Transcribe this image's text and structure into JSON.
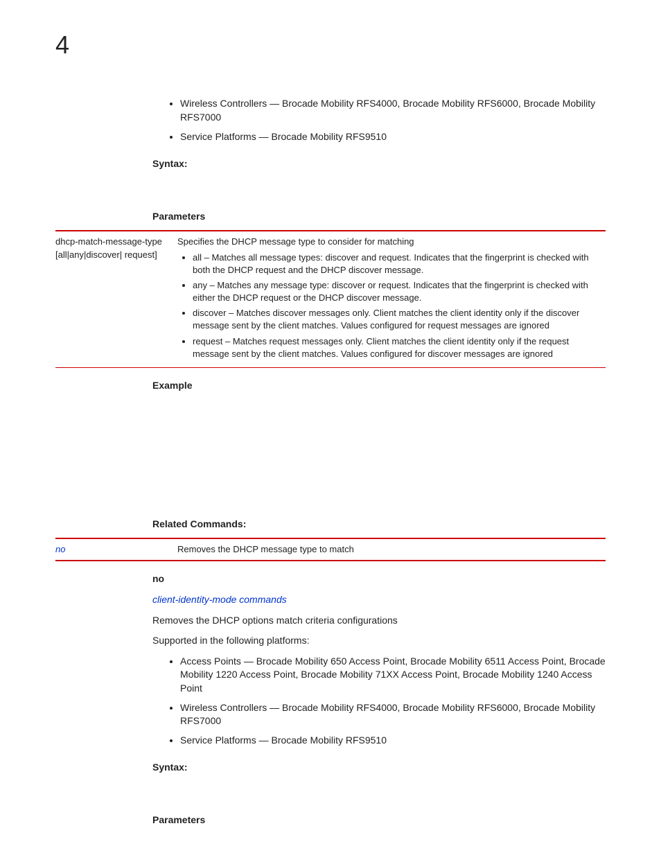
{
  "page_number": "4",
  "top_bullets": [
    "Wireless Controllers — Brocade Mobility RFS4000, Brocade Mobility RFS6000, Brocade Mobility RFS7000",
    "Service Platforms — Brocade Mobility RFS9510"
  ],
  "syntax_label": "Syntax:",
  "parameters_label": "Parameters",
  "param_row": {
    "left": "dhcp-match-message-type [all|any|discover| request]",
    "desc": "Specifies the DHCP message type to consider for matching",
    "items": [
      "all – Matches all message types: discover and request. Indicates that the fingerprint is checked with both the DHCP request and the DHCP discover message.",
      "any – Matches any message type: discover or request. Indicates that the fingerprint is checked with either the DHCP request or the DHCP discover message.",
      "discover – Matches discover messages only. Client matches the client identity only if the discover message sent by the client matches. Values configured for request messages are ignored",
      "request – Matches request messages only. Client matches the client identity only if the request message sent by the client matches. Values configured for discover messages are ignored"
    ]
  },
  "example_label": "Example",
  "related_label": "Related Commands:",
  "related_row": {
    "cmd": "no",
    "desc": "Removes the DHCP message type to match"
  },
  "no_section": {
    "heading": "no",
    "link": "client-identity-mode commands",
    "desc": "Removes the DHCP options match criteria configurations",
    "supported": "Supported in the following platforms:",
    "bullets": [
      "Access Points — Brocade Mobility 650 Access Point, Brocade Mobility 6511 Access Point, Brocade Mobility 1220 Access Point, Brocade Mobility 71XX Access Point, Brocade Mobility 1240 Access Point",
      "Wireless Controllers — Brocade Mobility RFS4000, Brocade Mobility RFS6000, Brocade Mobility RFS7000",
      "Service Platforms — Brocade Mobility RFS9510"
    ],
    "syntax_label": "Syntax:",
    "parameters_label": "Parameters"
  }
}
